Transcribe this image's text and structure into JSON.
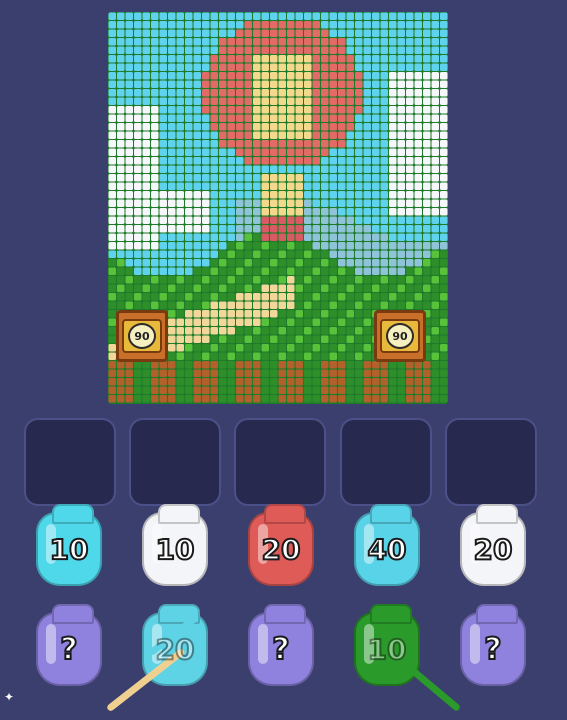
{
  "board": {
    "crates": [
      {
        "value": "90",
        "side": "left"
      },
      {
        "value": "90",
        "side": "right"
      }
    ],
    "colors": {
      "sky": "#5fd3ee",
      "cloud": "#f5f7fb",
      "balloon_red": "#e26a67",
      "balloon_cream": "#f3d98c",
      "basket": "#d85a62",
      "hill_blue": "#8ec3d8",
      "grass_dark": "#2e8f2a",
      "grass_light": "#58c23a",
      "path": "#f1d79a",
      "log": "#b2612a"
    }
  },
  "slots": [
    {
      "id": "slot-1"
    },
    {
      "id": "slot-2"
    },
    {
      "id": "slot-3"
    },
    {
      "id": "slot-4"
    },
    {
      "id": "slot-5"
    }
  ],
  "jars_row1": [
    {
      "label": "10",
      "color": "#4fd7ea"
    },
    {
      "label": "10",
      "color": "#f4f5f8"
    },
    {
      "label": "20",
      "color": "#df5b58"
    },
    {
      "label": "40",
      "color": "#59d3e8"
    },
    {
      "label": "20",
      "color": "#f4f5f8"
    }
  ],
  "jars_row2": [
    {
      "label": "?",
      "color": "#8f82df",
      "kind": "mystery"
    },
    {
      "label": "20",
      "color": "#5fd3e6",
      "kind": "faded"
    },
    {
      "label": "?",
      "color": "#8f82df",
      "kind": "mystery"
    },
    {
      "label": "10",
      "color": "#2a9a2a",
      "kind": "faded"
    },
    {
      "label": "?",
      "color": "#8f82df",
      "kind": "mystery"
    }
  ],
  "icons": {
    "corner": "sparkle-icon"
  }
}
